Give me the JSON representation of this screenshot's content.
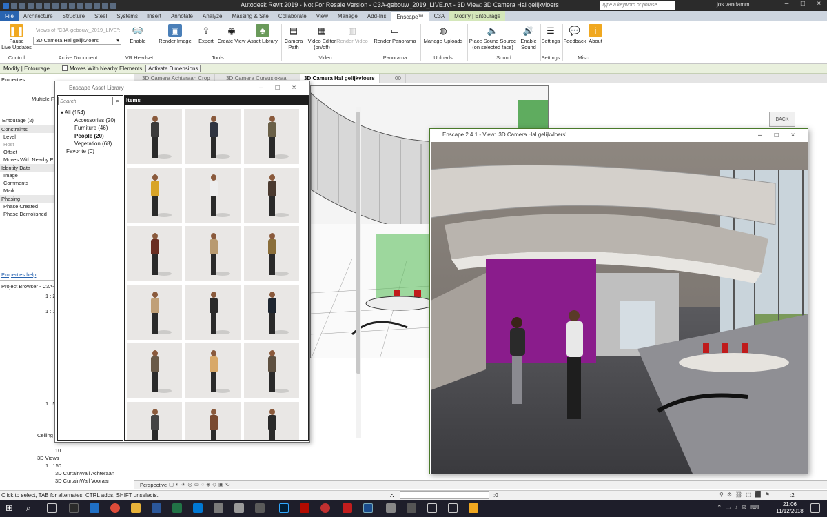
{
  "app": {
    "title": "Autodesk Revit 2019 - Not For Resale Version - C3A-gebouw_2019_LIVE.rvt - 3D View: 3D Camera Hal gelijkvloers",
    "search_placeholder": "Type a keyword or phrase",
    "user": "jos.vandamm..."
  },
  "ribbon_tabs": [
    "File",
    "Architecture",
    "Structure",
    "Steel",
    "Systems",
    "Insert",
    "Annotate",
    "Analyze",
    "Massing & Site",
    "Collaborate",
    "View",
    "Manage",
    "Add-Ins",
    "Enscape™",
    "C3A",
    "Modify | Entourage"
  ],
  "ribbon": {
    "pause_live_updates": "Pause\nLive Updates",
    "views_of": "Views of \"C3A-gebouw_2019_LIVE\":",
    "view_combo": "3D Camera Hal gelijkvloers",
    "enable": "Enable",
    "render_image": "Render Image",
    "export": "Export",
    "create_view": "Create View",
    "asset_library": "Asset Library",
    "camera_path": "Camera\nPath",
    "video_editor": "Video Editor\n(on/off)",
    "render_video": "Render Video",
    "render_panorama": "Render Panorama",
    "manage_uploads": "Manage Uploads",
    "place_sound_source": "Place Sound Source\n(on selected face)",
    "enable_sound": "Enable\nSound",
    "settings": "Settings",
    "feedback": "Feedback",
    "about": "About",
    "panels": {
      "control": "Control",
      "active_document": "Active Document",
      "vr_headset": "VR Headset",
      "tools": "Tools",
      "video": "Video",
      "panorama": "Panorama",
      "uploads": "Uploads",
      "sound": "Sound",
      "settings": "Settings",
      "misc": "Misc"
    }
  },
  "context_bar": {
    "modify": "Modify | Entourage",
    "moves_with": "Moves With Nearby Elements",
    "activate": "Activate Dimensions"
  },
  "properties": {
    "title": "Properties",
    "type": "Multiple F",
    "selector": "Entourage (2)",
    "groups": [
      {
        "name": "Constraints",
        "rows": [
          "Level",
          "Host",
          "Offset",
          "Moves With Nearby El..."
        ]
      },
      {
        "name": "Identity Data",
        "rows": [
          "Image",
          "Comments",
          "Mark"
        ]
      },
      {
        "name": "Phasing",
        "rows": [
          "Phase Created",
          "Phase Demolished"
        ]
      }
    ],
    "help": "Properties help"
  },
  "project_browser": {
    "title": "Project Browser - C3A-...",
    "items": [
      "1 : 2",
      "1 : 1",
      "1 : 5",
      "Ceiling",
      "10",
      "3D Views",
      "1 : 150",
      "3D CurtainWall Achteraan",
      "3D CurtainWall Vooraan"
    ]
  },
  "view_tabs": [
    "3D Camera Achteraan Crop",
    "3D Camera Cursuslokaal",
    "3D Camera Hal gelijkvloers",
    "00"
  ],
  "asset_library": {
    "title": "Enscape Asset Library",
    "search_placeholder": "Search",
    "items_header": "Items",
    "categories": [
      {
        "label": "All (154)",
        "bold": false
      },
      {
        "label": "Accessories (20)",
        "bold": false
      },
      {
        "label": "Furniture (46)",
        "bold": false
      },
      {
        "label": "People (20)",
        "bold": true
      },
      {
        "label": "Vegetation (68)",
        "bold": false
      }
    ],
    "favorite": "Favorite (0)"
  },
  "enscape_window": {
    "title": "Enscape 2.4.1 - View: '3D Camera Hal gelijkvloers'"
  },
  "view_control_bar": {
    "mode": "Perspective"
  },
  "status": {
    "text": "Click to select, TAB for alternates, CTRL adds, SHIFT unselects.",
    "zero1": ":0",
    "selected": ":2"
  },
  "viewcube": {
    "label": "BACK"
  },
  "clock": {
    "time": "21:06",
    "date": "11/12/2018"
  },
  "colors": {
    "ribbon_tab_bg": "#cdd5df",
    "file_tab": "#2964b0",
    "context_green": "#d4e7ba",
    "magenta_wall": "#8a1c8c",
    "titlebar": "#2b2b2b",
    "taskbar": "#1e1e2a"
  },
  "people_colors": [
    [
      "#3b3b3b",
      "#2f3440",
      "#6a6048"
    ],
    [
      "#d8a428",
      "#eeeeee",
      "#4a3a30"
    ],
    [
      "#6a2e22",
      "#b89a70",
      "#8a6e3a"
    ],
    [
      "#c0a078",
      "#2a2a2a",
      "#1e2630"
    ],
    [
      "#6a5a48",
      "#d8a868",
      "#5e5040"
    ],
    [
      "#444444",
      "#7a4a30",
      "#2a2a2a"
    ]
  ]
}
